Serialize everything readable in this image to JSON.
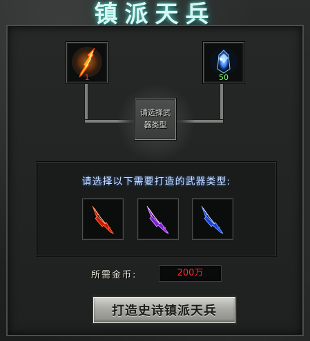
{
  "header": {
    "title": "镇派天兵"
  },
  "materials": [
    {
      "icon": "fire-staff-icon",
      "count": "1",
      "count_color": "#ff3030"
    },
    {
      "icon": "blue-crystal-icon",
      "count": "50",
      "count_color": "#7cff5c"
    }
  ],
  "selector": {
    "label": "请选择武器类型"
  },
  "weapon_panel": {
    "prompt": "请选择以下需要打造的武器类型:",
    "weapons": [
      {
        "icon": "red-sword-icon",
        "color": "#ff3a1a"
      },
      {
        "icon": "purple-sword-icon",
        "color": "#b23cff"
      },
      {
        "icon": "blue-sword-icon",
        "color": "#2b5dff"
      }
    ]
  },
  "cost": {
    "label": "所需金币:",
    "value": "200万"
  },
  "forge_button": {
    "label": "打造史诗镇派天兵"
  }
}
